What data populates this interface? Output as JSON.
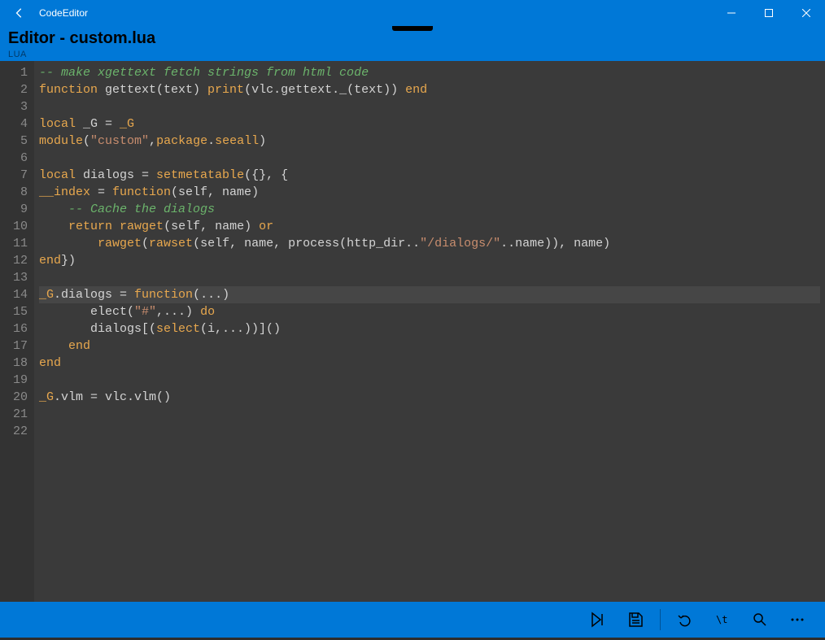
{
  "app": {
    "title": "CodeEditor"
  },
  "header": {
    "title": "Editor - custom.lua",
    "lang": "LUA"
  },
  "editor": {
    "current_line": 14,
    "lines": [
      {
        "n": 1,
        "tokens": [
          [
            "-- make xgettext fetch strings from html code",
            "c-comment"
          ]
        ]
      },
      {
        "n": 2,
        "tokens": [
          [
            "function",
            "c-keyword"
          ],
          [
            " gettext(text) ",
            "c-ident"
          ],
          [
            "print",
            "c-builtin"
          ],
          [
            "(vlc.gettext._(text)) ",
            "c-ident"
          ],
          [
            "end",
            "c-keyword"
          ]
        ]
      },
      {
        "n": 3,
        "tokens": [
          [
            "",
            "c-ident"
          ]
        ]
      },
      {
        "n": 4,
        "tokens": [
          [
            "local",
            "c-keyword"
          ],
          [
            " _G = ",
            "c-ident"
          ],
          [
            "_G",
            "c-builtin"
          ]
        ]
      },
      {
        "n": 5,
        "tokens": [
          [
            "module",
            "c-builtin"
          ],
          [
            "(",
            "c-paren"
          ],
          [
            "\"custom\"",
            "c-string"
          ],
          [
            ",",
            "c-ident"
          ],
          [
            "package",
            "c-builtin"
          ],
          [
            ".",
            "c-ident"
          ],
          [
            "seeall",
            "c-builtin"
          ],
          [
            ")",
            "c-paren"
          ]
        ]
      },
      {
        "n": 6,
        "tokens": [
          [
            "",
            "c-ident"
          ]
        ]
      },
      {
        "n": 7,
        "tokens": [
          [
            "local",
            "c-keyword"
          ],
          [
            " dialogs = ",
            "c-ident"
          ],
          [
            "setmetatable",
            "c-builtin"
          ],
          [
            "({}, {",
            "c-ident"
          ]
        ]
      },
      {
        "n": 8,
        "tokens": [
          [
            "__index",
            "c-builtin"
          ],
          [
            " = ",
            "c-ident"
          ],
          [
            "function",
            "c-keyword"
          ],
          [
            "(self, name)",
            "c-ident"
          ]
        ]
      },
      {
        "n": 9,
        "tokens": [
          [
            "    ",
            "c-ident"
          ],
          [
            "-- Cache the dialogs",
            "c-comment"
          ]
        ]
      },
      {
        "n": 10,
        "tokens": [
          [
            "    ",
            "c-ident"
          ],
          [
            "return",
            "c-keyword"
          ],
          [
            " ",
            "c-ident"
          ],
          [
            "rawget",
            "c-builtin"
          ],
          [
            "(self, name) ",
            "c-ident"
          ],
          [
            "or",
            "c-keyword"
          ]
        ]
      },
      {
        "n": 11,
        "tokens": [
          [
            "        ",
            "c-ident"
          ],
          [
            "rawget",
            "c-builtin"
          ],
          [
            "(",
            "c-ident"
          ],
          [
            "rawset",
            "c-builtin"
          ],
          [
            "(self, name, process(http_dir..",
            "c-ident"
          ],
          [
            "\"/dialogs/\"",
            "c-string"
          ],
          [
            "..name)), name)",
            "c-ident"
          ]
        ]
      },
      {
        "n": 12,
        "tokens": [
          [
            "end",
            "c-keyword"
          ],
          [
            "})",
            "c-ident"
          ]
        ]
      },
      {
        "n": 13,
        "tokens": [
          [
            "",
            "c-ident"
          ]
        ]
      },
      {
        "n": 14,
        "tokens": [
          [
            "_G",
            "c-builtin"
          ],
          [
            ".dialogs = ",
            "c-ident"
          ],
          [
            "function",
            "c-keyword"
          ],
          [
            "(...)",
            "c-ident"
          ]
        ]
      },
      {
        "n": 15,
        "tokens": [
          [
            "       elect(",
            "c-ident"
          ],
          [
            "\"#\"",
            "c-string"
          ],
          [
            ",...) ",
            "c-ident"
          ],
          [
            "do",
            "c-keyword"
          ]
        ]
      },
      {
        "n": 16,
        "tokens": [
          [
            "       dialogs[(",
            "c-ident"
          ],
          [
            "select",
            "c-builtin"
          ],
          [
            "(i,...))]()",
            "c-ident"
          ]
        ]
      },
      {
        "n": 17,
        "tokens": [
          [
            "    ",
            "c-ident"
          ],
          [
            "end",
            "c-keyword"
          ]
        ]
      },
      {
        "n": 18,
        "tokens": [
          [
            "end",
            "c-keyword"
          ]
        ]
      },
      {
        "n": 19,
        "tokens": [
          [
            "",
            "c-ident"
          ]
        ]
      },
      {
        "n": 20,
        "tokens": [
          [
            "_G",
            "c-builtin"
          ],
          [
            ".vlm = vlc.vlm()",
            "c-ident"
          ]
        ]
      },
      {
        "n": 21,
        "tokens": [
          [
            "",
            "c-ident"
          ]
        ]
      },
      {
        "n": 22,
        "tokens": [
          [
            "",
            "c-ident"
          ]
        ]
      }
    ]
  },
  "icons": {
    "back": "back-icon",
    "min": "minimize-icon",
    "max": "maximize-icon",
    "close": "close-icon",
    "run": "run-icon",
    "save": "save-icon",
    "undo": "undo-icon",
    "goto": "goto-icon",
    "find": "find-icon",
    "more": "more-icon"
  }
}
